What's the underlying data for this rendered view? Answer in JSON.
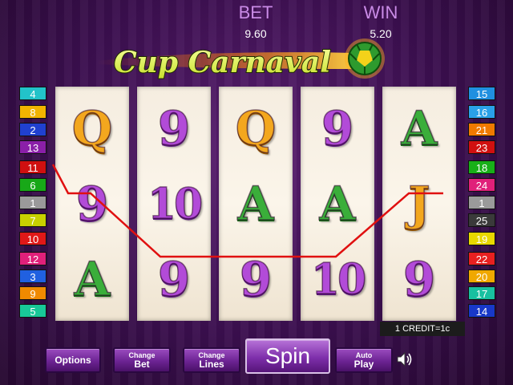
{
  "meters": {
    "bet_label": "BET",
    "bet_value": "9.60",
    "win_label": "WIN",
    "win_value": "5.20"
  },
  "logo": {
    "text": "Cup Carnaval"
  },
  "reels": [
    [
      "Q",
      "9",
      "A"
    ],
    [
      "9",
      "10",
      "9"
    ],
    [
      "Q",
      "A",
      "9"
    ],
    [
      "9",
      "A",
      "10"
    ],
    [
      "A",
      "J",
      "9"
    ]
  ],
  "line_badges_left": [
    {
      "num": "4",
      "color": "#22c3c9"
    },
    {
      "num": "8",
      "color": "#f2b400"
    },
    {
      "num": "2",
      "color": "#2040d0"
    },
    {
      "num": "13",
      "color": "#8a1fa8"
    },
    {
      "num": "11",
      "color": "#d01010"
    },
    {
      "num": "6",
      "color": "#18a818"
    },
    {
      "num": "1",
      "color": "#9a9a9a"
    },
    {
      "num": "7",
      "color": "#c8d000"
    },
    {
      "num": "10",
      "color": "#e01818"
    },
    {
      "num": "12",
      "color": "#e0207a"
    },
    {
      "num": "3",
      "color": "#2060e0"
    },
    {
      "num": "9",
      "color": "#f08a00"
    },
    {
      "num": "5",
      "color": "#18c898"
    }
  ],
  "line_badges_right": [
    {
      "num": "15",
      "color": "#2090e0"
    },
    {
      "num": "16",
      "color": "#2aa0e8"
    },
    {
      "num": "21",
      "color": "#f07a00"
    },
    {
      "num": "23",
      "color": "#d01010"
    },
    {
      "num": "18",
      "color": "#18b018"
    },
    {
      "num": "24",
      "color": "#e0207a"
    },
    {
      "num": "1",
      "color": "#9a9a9a"
    },
    {
      "num": "25",
      "color": "#3a3a3a"
    },
    {
      "num": "19",
      "color": "#e8d800"
    },
    {
      "num": "22",
      "color": "#e82020"
    },
    {
      "num": "20",
      "color": "#f0a800"
    },
    {
      "num": "17",
      "color": "#18c0a0"
    },
    {
      "num": "14",
      "color": "#1838c8"
    }
  ],
  "active_payline_color": "#e01010",
  "credit_label": "1 CREDIT=1c",
  "buttons": {
    "options": "Options",
    "change_bet_top": "Change",
    "change_bet_bottom": "Bet",
    "change_lines_top": "Change",
    "change_lines_bottom": "Lines",
    "spin": "Spin",
    "auto_play_top": "Auto",
    "auto_play_bottom": "Play"
  },
  "icons": {
    "sound": "speaker-icon",
    "ball": "soccer-ball-icon"
  }
}
